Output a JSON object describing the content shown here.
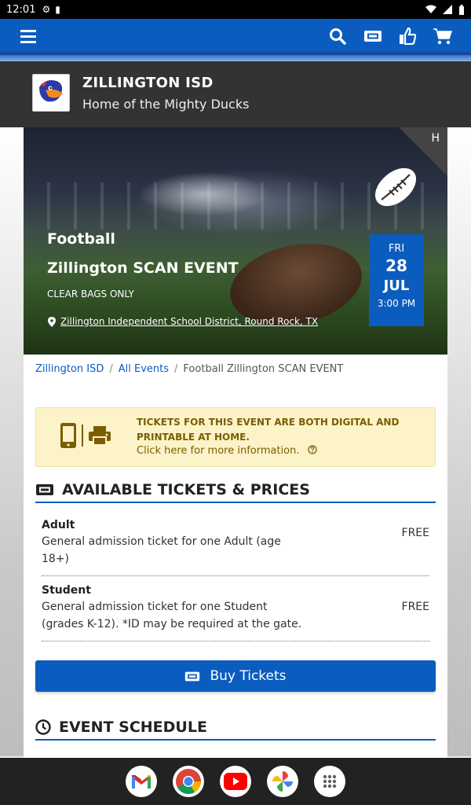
{
  "status_bar": {
    "time": "12:01"
  },
  "org": {
    "name": "ZILLINGTON ISD",
    "tagline": "Home of the Mighty Ducks"
  },
  "event": {
    "corner_label": "H",
    "category": "Football",
    "name": "Zillington SCAN EVENT",
    "note": "CLEAR BAGS ONLY",
    "venue": "Zillington Independent School District, Round Rock, TX",
    "date": {
      "dow": "FRI",
      "day": "28",
      "month": "JUL",
      "time": "3:00 PM"
    }
  },
  "breadcrumb": {
    "home": "Zillington ISD",
    "all_events": "All Events",
    "current": "Football Zillington SCAN EVENT",
    "separator": "/"
  },
  "notice": {
    "title": "TICKETS FOR THIS EVENT ARE BOTH DIGITAL AND PRINTABLE AT HOME.",
    "link": "Click here for more information."
  },
  "tickets_section": {
    "heading": "AVAILABLE TICKETS & PRICES",
    "items": [
      {
        "name": "Adult",
        "desc": "General admission ticket for one Adult (age 18+)",
        "price": "FREE"
      },
      {
        "name": "Student",
        "desc": "General admission ticket for one Student (grades K-12). *ID may be required at the gate.",
        "price": "FREE"
      }
    ]
  },
  "buy_button": {
    "label": "Buy Tickets"
  },
  "schedule_section": {
    "heading": "EVENT SCHEDULE"
  },
  "colors": {
    "brand_blue": "#0b5cbf",
    "org_header": "#333333",
    "notice_bg": "#fdf3c9",
    "notice_text": "#7a5e00"
  },
  "nav_icons": [
    "menu-icon",
    "search-icon",
    "ticket-icon",
    "thumbs-up-icon",
    "cart-icon"
  ],
  "dock_apps": [
    "gmail-icon",
    "chrome-icon",
    "youtube-icon",
    "photos-icon",
    "app-drawer-icon"
  ]
}
